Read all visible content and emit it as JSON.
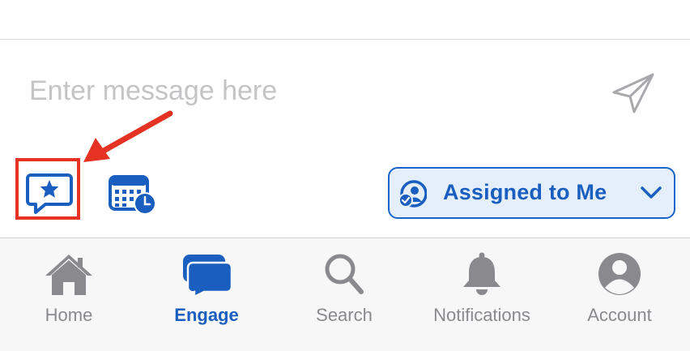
{
  "composer": {
    "placeholder": "Enter message here"
  },
  "toolbar": {
    "favorites_icon": "star-message-icon",
    "schedule_icon": "calendar-clock-icon",
    "send_icon": "paper-plane-icon"
  },
  "assignment": {
    "label": "Assigned to Me",
    "icon": "person-check-icon",
    "chevron": "chevron-down-icon"
  },
  "annotation": {
    "highlight_color": "#e53222"
  },
  "tabs": [
    {
      "label": "Home",
      "icon": "house-icon",
      "active": false
    },
    {
      "label": "Engage",
      "icon": "chat-bubbles-icon",
      "active": true
    },
    {
      "label": "Search",
      "icon": "magnifier-icon",
      "active": false
    },
    {
      "label": "Notifications",
      "icon": "bell-icon",
      "active": false
    },
    {
      "label": "Account",
      "icon": "person-circle-icon",
      "active": false
    }
  ],
  "colors": {
    "accent": "#1a5fbf",
    "accent_bg": "#e5effb",
    "inactive": "#8a8a8e"
  }
}
